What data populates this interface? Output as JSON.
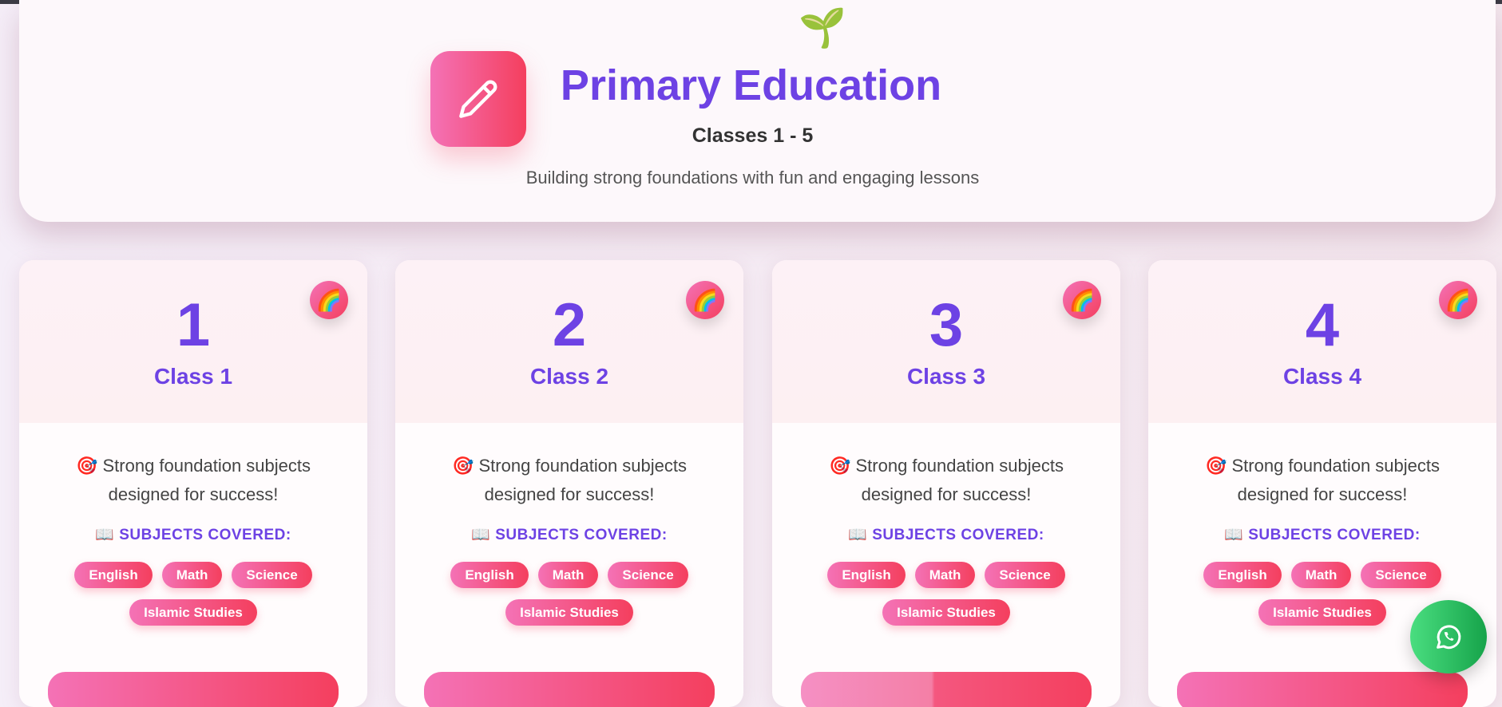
{
  "hero": {
    "emoji": "🌱",
    "title": "Primary Education",
    "classes": "Classes 1 - 5",
    "subtitle": "Building strong foundations with fun and engaging lessons"
  },
  "cards": [
    {
      "number": "1",
      "label": "Class 1",
      "badge": "🌈",
      "desc": "🎯 Strong foundation subjects designed for success!",
      "subjects_heading": "📖 SUBJECTS COVERED:",
      "subjects": [
        "English",
        "Math",
        "Science",
        "Islamic Studies"
      ]
    },
    {
      "number": "2",
      "label": "Class 2",
      "badge": "🌈",
      "desc": "🎯 Strong foundation subjects designed for success!",
      "subjects_heading": "📖 SUBJECTS COVERED:",
      "subjects": [
        "English",
        "Math",
        "Science",
        "Islamic Studies"
      ]
    },
    {
      "number": "3",
      "label": "Class 3",
      "badge": "🌈",
      "desc": "🎯 Strong foundation subjects designed for success!",
      "subjects_heading": "📖 SUBJECTS COVERED:",
      "subjects": [
        "English",
        "Math",
        "Science",
        "Islamic Studies"
      ]
    },
    {
      "number": "4",
      "label": "Class 4",
      "badge": "🌈",
      "desc": "🎯 Strong foundation subjects designed for success!",
      "subjects_heading": "📖 SUBJECTS COVERED:",
      "subjects": [
        "English",
        "Math",
        "Science",
        "Islamic Studies"
      ]
    }
  ],
  "colors": {
    "accent": "#6d42e4",
    "pink_start": "#f472b6",
    "pink_end": "#f43f5e",
    "whatsapp": "#22c55e"
  }
}
